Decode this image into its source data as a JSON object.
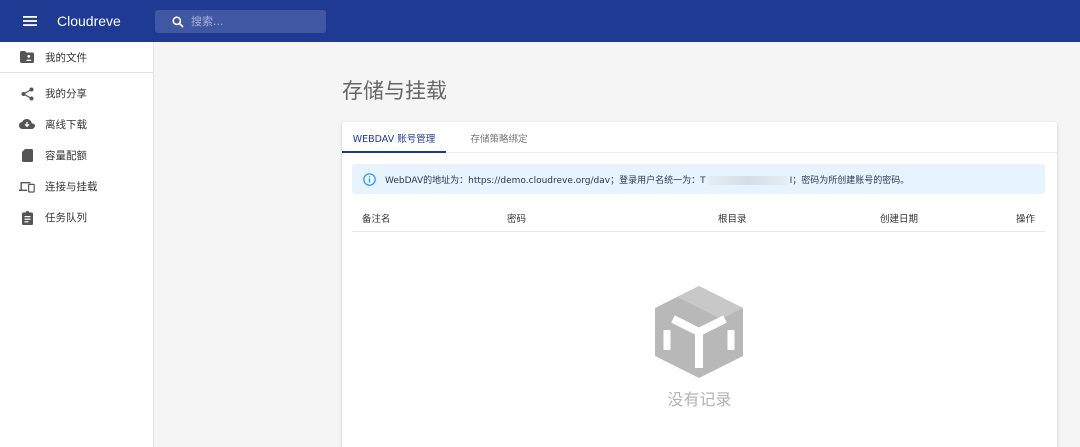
{
  "app": {
    "title": "Cloudreve"
  },
  "search": {
    "placeholder": "搜索..."
  },
  "sidebar": {
    "items": [
      {
        "label": "我的文件",
        "icon": "folder-user-icon"
      },
      {
        "label": "我的分享",
        "icon": "share-icon"
      },
      {
        "label": "离线下载",
        "icon": "cloud-download-icon"
      },
      {
        "label": "容量配额",
        "icon": "sd-card-icon"
      },
      {
        "label": "连接与挂载",
        "icon": "devices-icon"
      },
      {
        "label": "任务队列",
        "icon": "clipboard-list-icon"
      }
    ]
  },
  "page": {
    "title": "存储与挂载"
  },
  "tabs": [
    {
      "label": "WEBDAV 账号管理",
      "active": true
    },
    {
      "label": "存储策略绑定",
      "active": false
    }
  ],
  "alert": {
    "prefix": "WebDAV的地址为：https://demo.cloudreve.org/dav；登录用户名统一为：",
    "masked_start": "T",
    "masked_end": "I",
    "suffix": "；密码为所创建账号的密码。"
  },
  "table": {
    "headers": [
      "备注名",
      "密码",
      "根目录",
      "创建日期",
      "操作"
    ]
  },
  "empty": {
    "text": "没有记录"
  },
  "colors": {
    "primary": "#1f3a93",
    "alert_bg": "#e8f4fd",
    "empty_icon": "#b8b8b8"
  }
}
